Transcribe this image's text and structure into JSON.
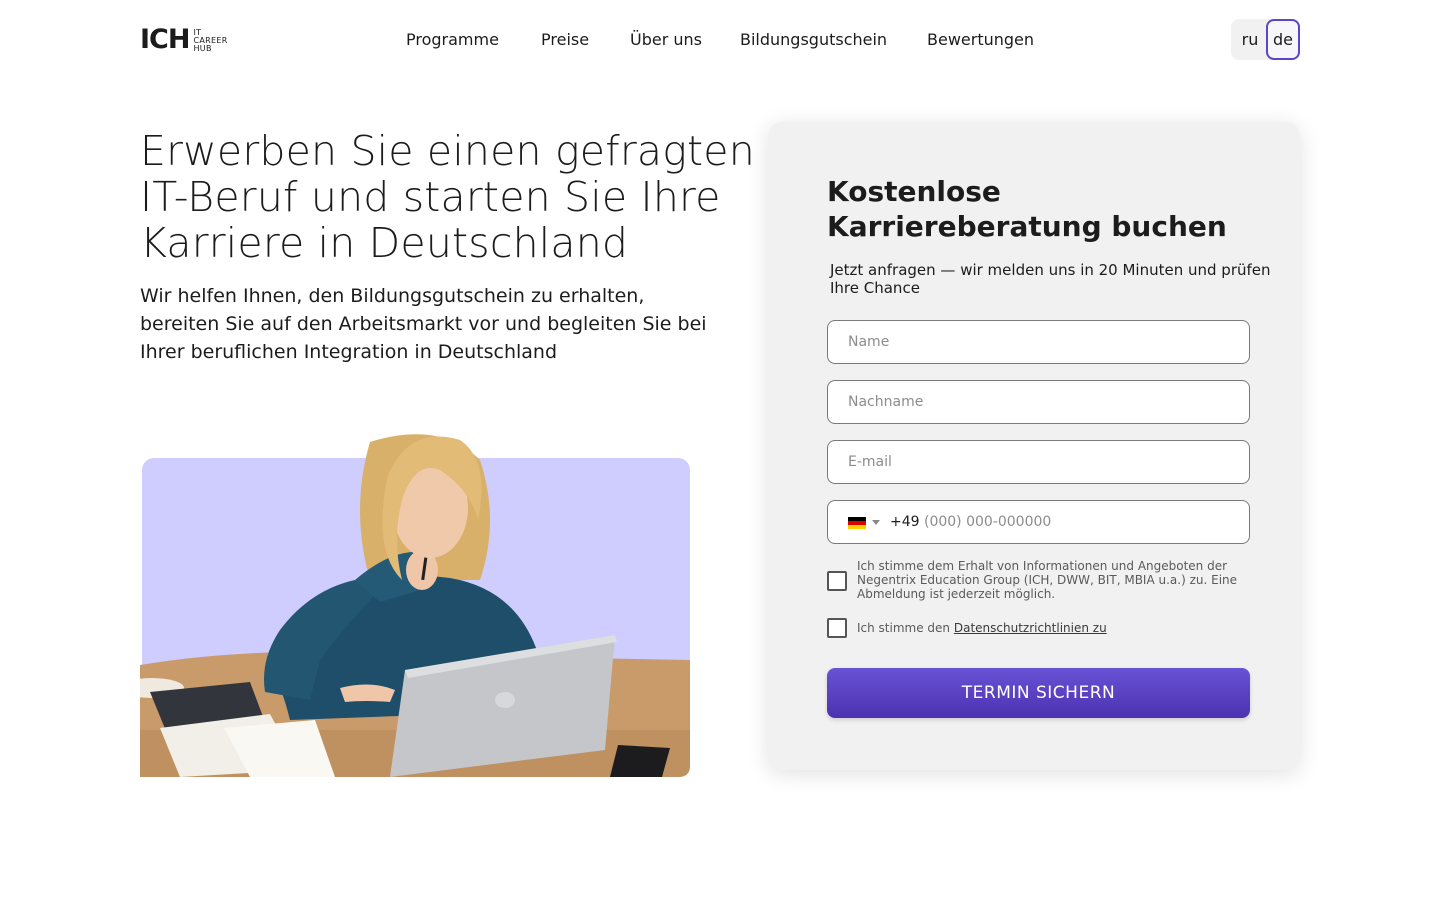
{
  "header": {
    "logo": {
      "mark": "ICH",
      "lines": [
        "IT",
        "CAREER",
        "HUB"
      ]
    },
    "nav": [
      "Programme",
      "Preise",
      "Über uns",
      "Bildungsgutschein",
      "Bewertungen"
    ],
    "languages": {
      "ru": "ru",
      "de": "de",
      "active": "de"
    }
  },
  "hero": {
    "title": "Erwerben Sie einen gefragten IT-Beruf und starten Sie Ihre Karriere in Deutschland",
    "subtitle": "Wir helfen Ihnen, den Bildungsgutschein zu erhalten, bereiten Sie auf den Arbeitsmarkt vor und begleiten Sie bei Ihrer beruflichen Integration in Deutschland"
  },
  "form": {
    "title": "Kostenlose Karriereberatung buchen",
    "subtitle": "Jetzt anfragen — wir melden uns in 20 Minuten und prüfen Ihre Chance",
    "name_placeholder": "Name",
    "lastname_placeholder": "Nachname",
    "email_placeholder": "E-mail",
    "phone": {
      "country_code": "+49",
      "placeholder": "(000) 000-000000",
      "flag_colors": [
        "#000000",
        "#dd0000",
        "#ffce00"
      ]
    },
    "consent_marketing": "Ich stimme dem Erhalt von Informationen und Angeboten der Negentrix Education Group (ICH, DWW, BIT, MBIA u.a.) zu. Eine Abmeldung ist jederzeit möglich.",
    "consent_privacy_prefix": "Ich stimme den ",
    "consent_privacy_link": "Datenschutzrichtlinien zu",
    "submit_label": "TERMIN SICHERN"
  },
  "colors": {
    "accent": "#5a46c8",
    "image_bg": "#cecdfd",
    "logo_accent": "#b8e000"
  }
}
